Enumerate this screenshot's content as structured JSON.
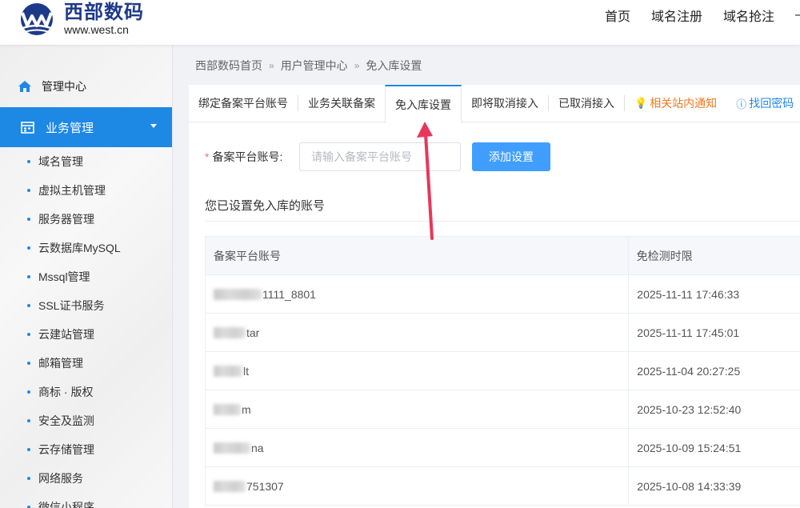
{
  "header": {
    "logo_cn": "西部数码",
    "logo_en": "www.west.cn",
    "nav": [
      "首页",
      "域名注册",
      "域名抢注",
      "—"
    ]
  },
  "sidebar": {
    "home": "管理中心",
    "active": "业务管理",
    "items": [
      "域名管理",
      "虚拟主机管理",
      "服务器管理",
      "云数据库MySQL",
      "Mssql管理",
      "SSL证书服务",
      "云建站管理",
      "邮箱管理",
      "商标 · 版权",
      "安全及监测",
      "云存储管理",
      "网络服务",
      "微信小程序"
    ]
  },
  "breadcrumb": [
    "西部数码首页",
    "用户管理中心",
    "免入库设置"
  ],
  "tabs": [
    {
      "label": "绑定备案平台账号"
    },
    {
      "label": "业务关联备案"
    },
    {
      "label": "免入库设置"
    },
    {
      "label": "即将取消接入"
    },
    {
      "label": "已取消接入"
    },
    {
      "label": "相关站内通知"
    },
    {
      "label": "找回密码"
    }
  ],
  "form": {
    "required_mark": "*",
    "label": "备案平台账号:",
    "placeholder": "请输入备案平台账号",
    "button": "添加设置"
  },
  "section_title": "您已设置免入库的账号",
  "table": {
    "headers": [
      "备案平台账号",
      "免检测时限"
    ],
    "rows": [
      {
        "account": "1111_8801",
        "time": "2025-11-11 17:46:33"
      },
      {
        "account": "tar",
        "time": "2025-11-11 17:45:01"
      },
      {
        "account": "lt",
        "time": "2025-11-04 20:27:25"
      },
      {
        "account": "m",
        "time": "2025-10-23 12:52:40"
      },
      {
        "account": "na",
        "time": "2025-10-09 15:24:51"
      },
      {
        "account": "751307",
        "time": "2025-10-08 14:33:39"
      }
    ]
  },
  "colors": {
    "accent": "#1e88e5",
    "button": "#409eff",
    "annotation": "#e8365a",
    "notice": "#f0781e"
  }
}
